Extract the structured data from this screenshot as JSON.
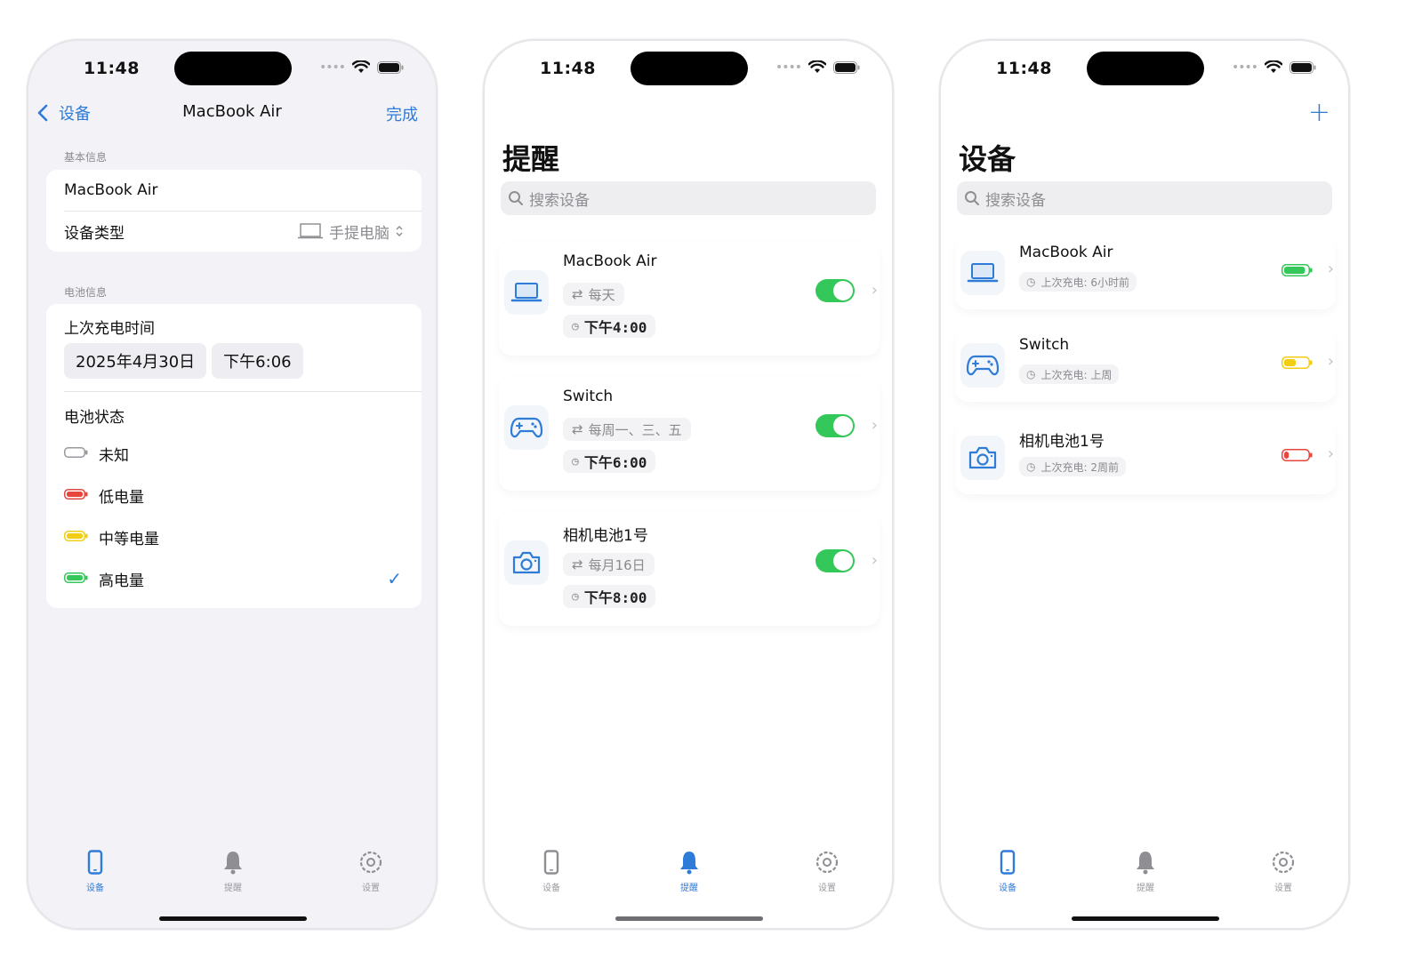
{
  "status": {
    "time": "11:48"
  },
  "tabs": [
    {
      "label": "设备",
      "icon": "phone-icon"
    },
    {
      "label": "提醒",
      "icon": "bell-icon"
    },
    {
      "label": "设置",
      "icon": "gear-icon"
    }
  ],
  "edit_screen": {
    "back_label": "设备",
    "title": "MacBook Air",
    "done_label": "完成",
    "basic_section_header": "基本信息",
    "device_name": "MacBook Air",
    "device_type_label": "设备类型",
    "device_type_value": "手提电脑",
    "battery_section_header": "电池信息",
    "last_charge_label": "上次充电时间",
    "last_charge_date": "2025年4月30日",
    "last_charge_time": "下午6:06",
    "battery_status_label": "电池状态",
    "battery_options": [
      {
        "label": "未知",
        "color": "#ffffff"
      },
      {
        "label": "低电量",
        "color": "#e8453c"
      },
      {
        "label": "中等电量",
        "color": "#f2cd16"
      },
      {
        "label": "高电量",
        "color": "#34c759",
        "selected": true
      }
    ]
  },
  "reminders_screen": {
    "title": "提醒",
    "search_placeholder": "搜索设备",
    "items": [
      {
        "name": "MacBook Air",
        "icon": "laptop-icon",
        "repeat": "每天",
        "time": "下午4:00",
        "enabled": true
      },
      {
        "name": "Switch",
        "icon": "gamepad-icon",
        "repeat": "每周一、三、五",
        "time": "下午6:00",
        "enabled": true
      },
      {
        "name": "相机电池1号",
        "icon": "camera-icon",
        "repeat": "每月16日",
        "time": "下午8:00",
        "enabled": true
      }
    ]
  },
  "devices_screen": {
    "title": "设备",
    "search_placeholder": "搜索设备",
    "add_label": "+",
    "items": [
      {
        "name": "MacBook Air",
        "icon": "laptop-icon",
        "last_charge": "上次充电: 6小时前",
        "battery_color": "#34c759",
        "battery_level": 0.9
      },
      {
        "name": "Switch",
        "icon": "gamepad-icon",
        "last_charge": "上次充电: 上周",
        "battery_color": "#f2cd16",
        "battery_level": 0.5
      },
      {
        "name": "相机电池1号",
        "icon": "camera-icon",
        "last_charge": "上次充电: 2周前",
        "battery_color": "#e8453c",
        "battery_level": 0.2
      }
    ]
  },
  "colors": {
    "accent": "#2f7bd8",
    "toggle_on": "#34c759"
  }
}
